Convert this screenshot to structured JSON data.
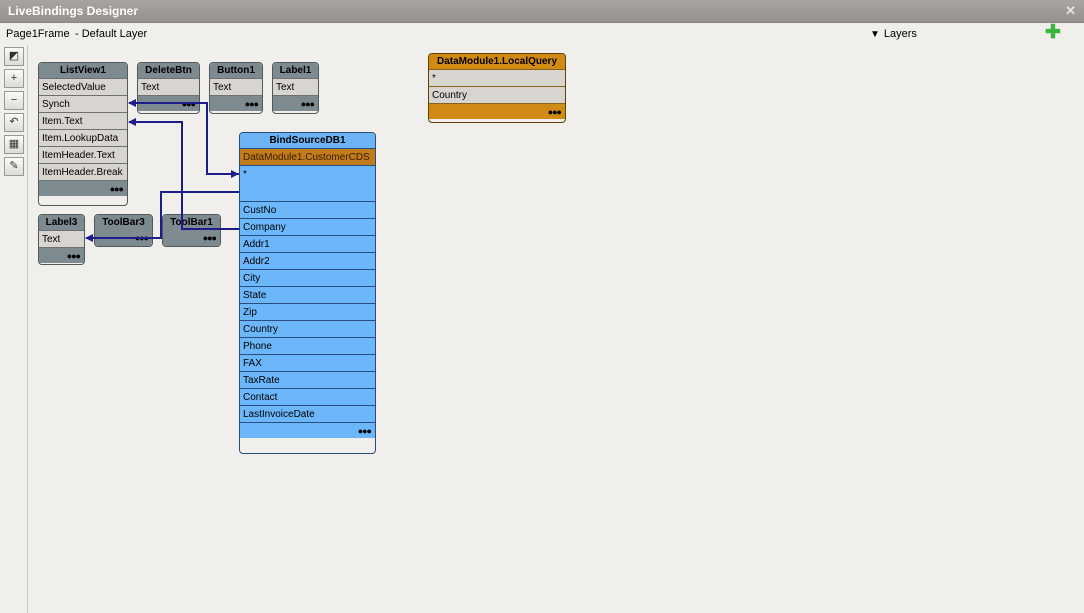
{
  "window": {
    "title": "LiveBindings Designer",
    "close_glyph": "✕"
  },
  "infobar": {
    "frame": "Page1Frame",
    "layer": "- Default Layer",
    "layers_label": "Layers",
    "add_glyph": "✚"
  },
  "toolbar": {
    "tools": [
      {
        "name": "zoom-fit-icon",
        "glyph": "◩"
      },
      {
        "name": "zoom-in-icon",
        "glyph": "+"
      },
      {
        "name": "zoom-out-icon",
        "glyph": "−"
      },
      {
        "name": "rearrange-icon",
        "glyph": "↶"
      },
      {
        "name": "grid-layout-icon",
        "glyph": "▦"
      },
      {
        "name": "bind-visually-icon",
        "glyph": "✎"
      }
    ]
  },
  "nodes": {
    "listview1": {
      "title": "ListView1",
      "fields": [
        "SelectedValue",
        "Synch",
        "Item.Text",
        "Item.LookupData",
        "ItemHeader.Text",
        "ItemHeader.Break"
      ]
    },
    "deletebtn": {
      "title": "DeleteBtn",
      "fields": [
        "Text"
      ]
    },
    "button1": {
      "title": "Button1",
      "fields": [
        "Text"
      ]
    },
    "label1": {
      "title": "Label1",
      "fields": [
        "Text"
      ]
    },
    "label3": {
      "title": "Label3",
      "fields": [
        "Text"
      ]
    },
    "toolbar3": {
      "title": "ToolBar3"
    },
    "toolbar1": {
      "title": "ToolBar1"
    },
    "bindsource": {
      "title": "BindSourceDB1",
      "dataset": "DataModule1.CustomerCDS",
      "star": "*",
      "fields": [
        "CustNo",
        "Company",
        "Addr1",
        "Addr2",
        "City",
        "State",
        "Zip",
        "Country",
        "Phone",
        "FAX",
        "TaxRate",
        "Contact",
        "LastInvoiceDate"
      ]
    },
    "localquery": {
      "title": "DataModule1.LocalQuery",
      "fields": [
        "*",
        "Country"
      ]
    }
  },
  "more_glyph": "●●●",
  "colors": {
    "link": "#1c1c8c",
    "bindsource": "#6cb6fa",
    "dataset": "#c17b1a",
    "component": "#7d8a90"
  }
}
